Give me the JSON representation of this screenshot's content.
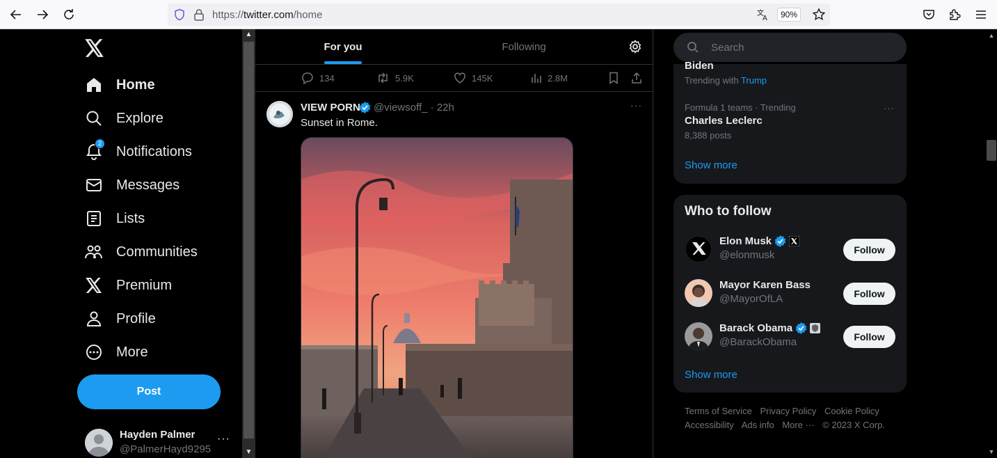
{
  "browser": {
    "url_prefix": "https://",
    "url_host": "twitter.com",
    "url_path": "/home",
    "zoom": "90%"
  },
  "sidebar": {
    "items": [
      {
        "label": "Home",
        "icon": "home-icon"
      },
      {
        "label": "Explore",
        "icon": "search-icon"
      },
      {
        "label": "Notifications",
        "icon": "bell-icon",
        "badge": "2"
      },
      {
        "label": "Messages",
        "icon": "envelope-icon"
      },
      {
        "label": "Lists",
        "icon": "list-icon"
      },
      {
        "label": "Communities",
        "icon": "people-icon"
      },
      {
        "label": "Premium",
        "icon": "x-logo-icon"
      },
      {
        "label": "Profile",
        "icon": "person-icon"
      },
      {
        "label": "More",
        "icon": "more-circle-icon"
      }
    ],
    "post_label": "Post",
    "account": {
      "name": "Hayden Palmer",
      "handle": "@PalmerHayd9295",
      "more": "···"
    }
  },
  "main": {
    "tabs": [
      {
        "label": "For you"
      },
      {
        "label": "Following"
      }
    ],
    "actions": {
      "replies": "134",
      "reposts": "5.9K",
      "likes": "145K",
      "views": "2.8M"
    },
    "tweet": {
      "name": "VIEW PORN",
      "handle": "@viewsoff_ · 22h",
      "text": "Sunset in Rome.",
      "more": "···"
    }
  },
  "right": {
    "search_placeholder": "Search",
    "trend_cut_title": "Biden",
    "trend_sub_prefix": "Trending with",
    "trend_sub_link": "Trump",
    "trend2": {
      "meta": "Formula 1 teams · Trending",
      "name": "Charles Leclerc",
      "count": "8,388 posts",
      "more": "···"
    },
    "show_more_1": "Show more",
    "who_to_follow_title": "Who to follow",
    "follow_suggestions": [
      {
        "name": "Elon Musk",
        "handle": "@elonmusk",
        "button": "Follow"
      },
      {
        "name": "Mayor Karen Bass",
        "handle": "@MayorOfLA",
        "button": "Follow"
      },
      {
        "name": "Barack Obama",
        "handle": "@BarackObama",
        "button": "Follow"
      }
    ],
    "show_more_2": "Show more",
    "footer": [
      "Terms of Service",
      "Privacy Policy",
      "Cookie Policy",
      "Accessibility",
      "Ads info",
      "More ···",
      "© 2023 X Corp."
    ]
  },
  "colors": {
    "accent": "#1d9bf0",
    "bg": "#000000",
    "card": "#16181c",
    "muted": "#71767b",
    "text": "#e7e9ea"
  }
}
